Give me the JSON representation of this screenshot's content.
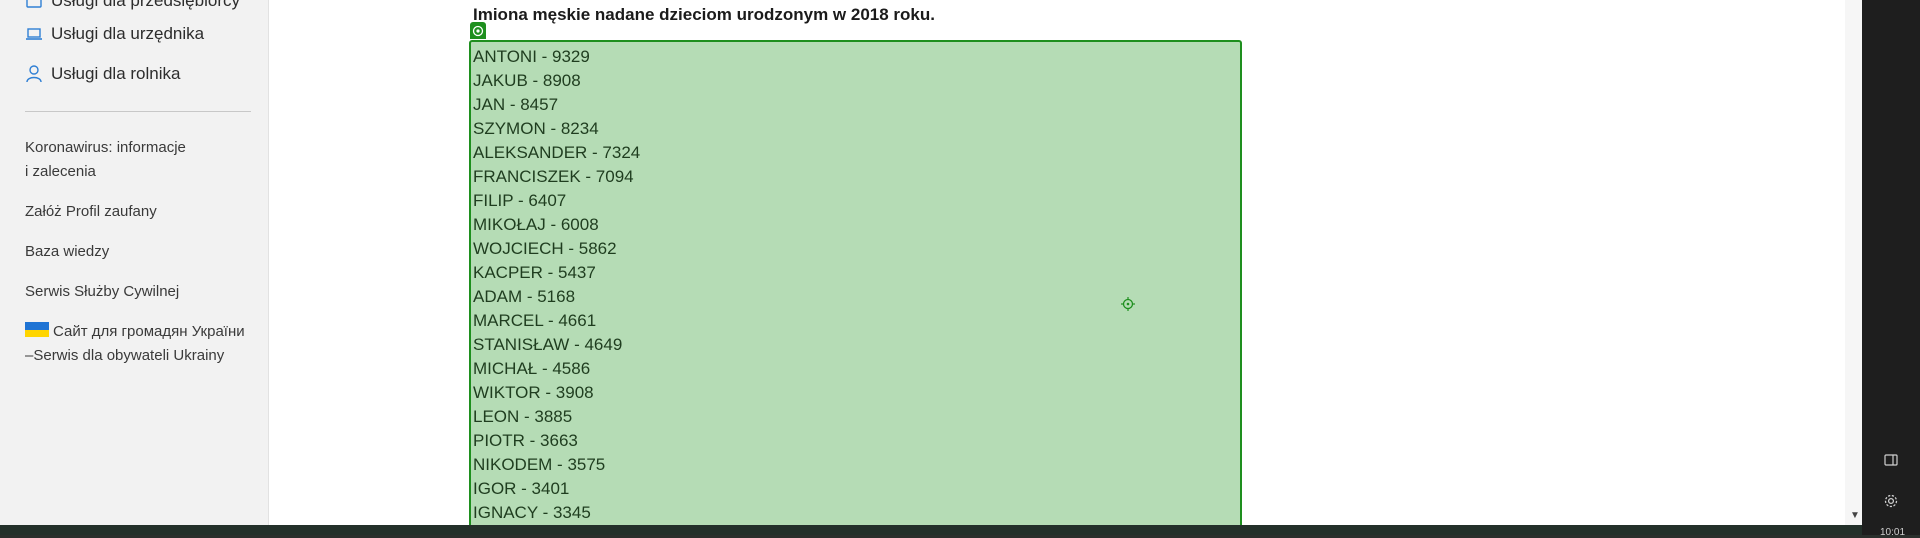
{
  "sidebar": {
    "items": [
      {
        "label": "Usługi dla przedsiębiorcy",
        "icon": "briefcase-icon"
      },
      {
        "label": "Usługi dla urzędnika",
        "icon": "laptop-icon"
      },
      {
        "label": "Usługi dla rolnika",
        "icon": "user-icon"
      }
    ],
    "links": [
      {
        "line1": "Koronawirus: informacje",
        "line2": "i zalecenia"
      },
      {
        "line1": "Załóż Profil zaufany"
      },
      {
        "line1": "Baza wiedzy"
      },
      {
        "line1": "Serwis Służby Cywilnej"
      },
      {
        "line1": "Сайт для громадян України",
        "line2": "–Serwis dla obywateli Ukrainy",
        "flag": "ukraine-flag"
      }
    ]
  },
  "main": {
    "heading": "Imiona męskie nadane dzieciom urodzonym w 2018 roku.",
    "names": [
      "ANTONI - 9329",
      "JAKUB - 8908",
      "JAN - 8457",
      "SZYMON - 8234",
      "ALEKSANDER - 7324",
      "FRANCISZEK - 7094",
      "FILIP - 6407",
      "MIKOŁAJ - 6008",
      "WOJCIECH - 5862",
      "KACPER - 5437",
      "ADAM - 5168",
      "MARCEL - 4661",
      "STANISŁAW - 4649",
      "MICHAŁ - 4586",
      "WIKTOR - 3908",
      "LEON - 3885",
      "PIOTR - 3663",
      "NIKODEM - 3575",
      "IGOR - 3401",
      "IGNACY - 3345"
    ]
  },
  "right_panel": {
    "icons": [
      "sidebar-toggle-icon",
      "gear-icon"
    ],
    "time": "10:01"
  },
  "colors": {
    "selection_fill": "#b5dcb5",
    "selection_border": "#1e8f1e"
  }
}
